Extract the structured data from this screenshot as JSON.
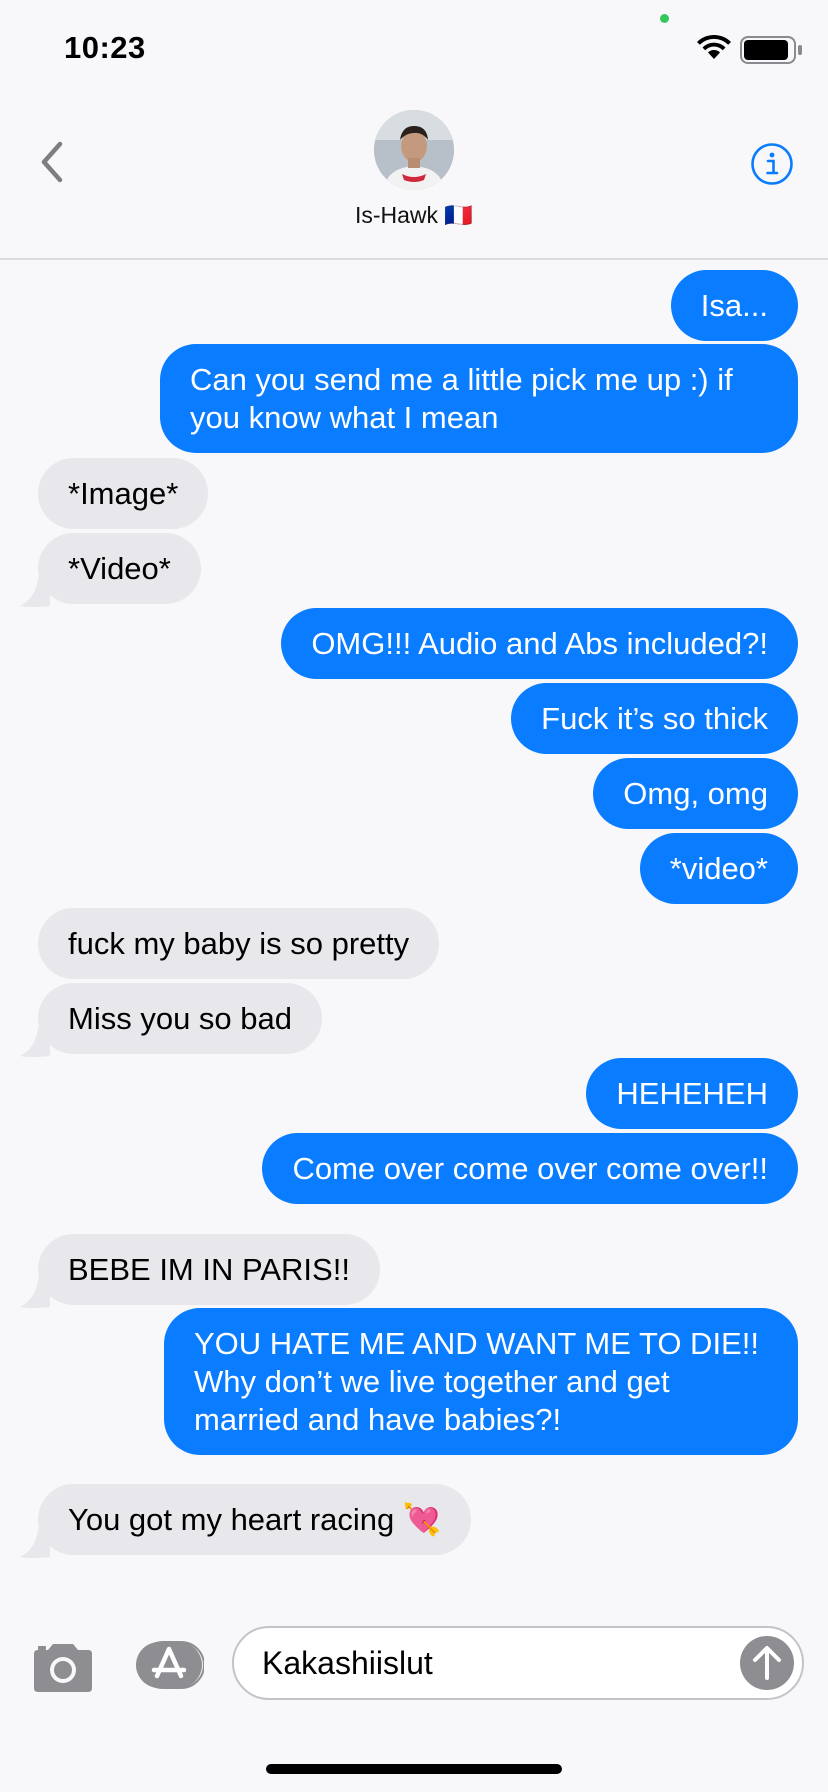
{
  "status": {
    "time": "10:23"
  },
  "header": {
    "contact_name": "Is-Hawk 🇫🇷"
  },
  "messages": [
    {
      "dir": "out",
      "text": "Isa..."
    },
    {
      "dir": "out",
      "text": "Can you send me a little pick me up :) if you know what I mean"
    },
    {
      "dir": "in",
      "text": "*Image*"
    },
    {
      "dir": "in",
      "text": "*Video*"
    },
    {
      "dir": "out",
      "text": "OMG!!! Audio and Abs included?!"
    },
    {
      "dir": "out",
      "text": "Fuck it’s so thick"
    },
    {
      "dir": "out",
      "text": "Omg, omg"
    },
    {
      "dir": "out",
      "text": "*video*"
    },
    {
      "dir": "in",
      "text": "fuck my baby is so pretty"
    },
    {
      "dir": "in",
      "text": "Miss you so bad"
    },
    {
      "dir": "out",
      "text": "HEHEHEH"
    },
    {
      "dir": "out",
      "text": "Come over come over come over!!"
    },
    {
      "dir": "in",
      "text": "BEBE IM IN PARIS!!"
    },
    {
      "dir": "out",
      "text": "YOU HATE ME AND WANT ME TO DIE!! Why don’t we live together and get married and have babies?!"
    },
    {
      "dir": "in",
      "text": "You got my heart racing 💘"
    }
  ],
  "input": {
    "value": "Kakashiislut"
  },
  "icons": {
    "back": "chevron-left-icon",
    "info": "info-icon",
    "camera": "camera-icon",
    "apps": "app-store-icon",
    "send": "arrow-up-icon"
  },
  "colors": {
    "outgoing": "#0a7cff",
    "incoming": "#e8e7ec",
    "accent": "#0a7cff"
  }
}
